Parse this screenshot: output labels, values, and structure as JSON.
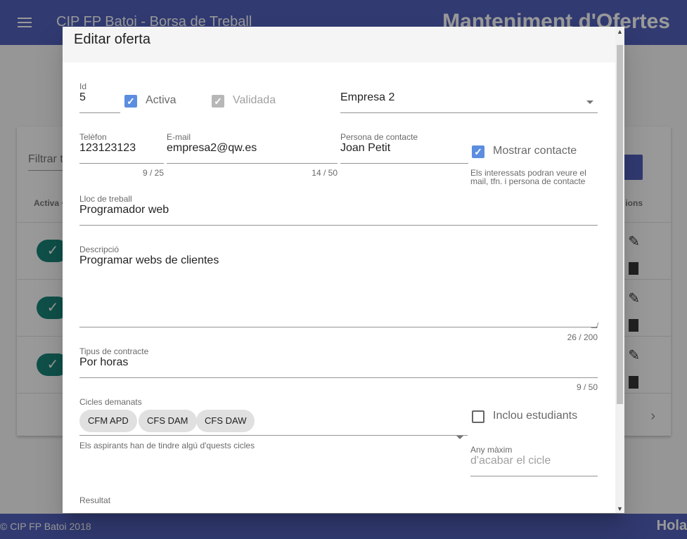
{
  "app": {
    "title": "CIP FP Batoi - Borsa de Treball",
    "page_heading": "Manteniment d'Ofertes",
    "filter_placeholder": "Filtrar t",
    "table": {
      "col_active": "Activa ^",
      "col_actions": "ions"
    },
    "footer_copy": "© CIP FP Batoi 2018",
    "footer_right": "Hola",
    "colors": {
      "primary": "#3f51b5",
      "accent": "#00796b",
      "checkbox": "#5c8ee0"
    }
  },
  "dialog": {
    "title": "Editar oferta",
    "id": {
      "label": "Id",
      "value": "5"
    },
    "activa": {
      "label": "Activa",
      "checked": true
    },
    "validada": {
      "label": "Validada",
      "checked": true,
      "disabled": true
    },
    "empresa": {
      "value": "Empresa 2"
    },
    "telefon": {
      "label": "Telèfon",
      "value": "123123123",
      "counter": "9 / 25"
    },
    "email": {
      "label": "E-mail",
      "value": "empresa2@qw.es",
      "counter": "14 / 50"
    },
    "contacte": {
      "label": "Persona de contacte",
      "value": "Joan Petit"
    },
    "mostrar_contacte": {
      "label": "Mostrar contacte",
      "checked": true,
      "hint": "Els interessats podran veure el mail, tfn. i persona de contacte"
    },
    "lloc": {
      "label": "Lloc de treball",
      "value": "Programador web"
    },
    "descripcio": {
      "label": "Descripció",
      "value": "Programar webs de clientes",
      "counter": "26 / 200"
    },
    "contracte": {
      "label": "Tipus de contracte",
      "value": "Por horas",
      "counter": "9 / 50"
    },
    "cicles": {
      "label": "Cicles demanats",
      "chips": [
        "CFM APD",
        "CFS DAM",
        "CFS DAW"
      ],
      "hint": "Els aspirants han de tindre algú d'quests cicles"
    },
    "inclou_estudiants": {
      "label": "Inclou estudiants",
      "checked": false
    },
    "any_maxim": {
      "label": "Any màxim",
      "placeholder": "d'acabar el cicle"
    },
    "resultat": {
      "label": "Resultat"
    }
  }
}
